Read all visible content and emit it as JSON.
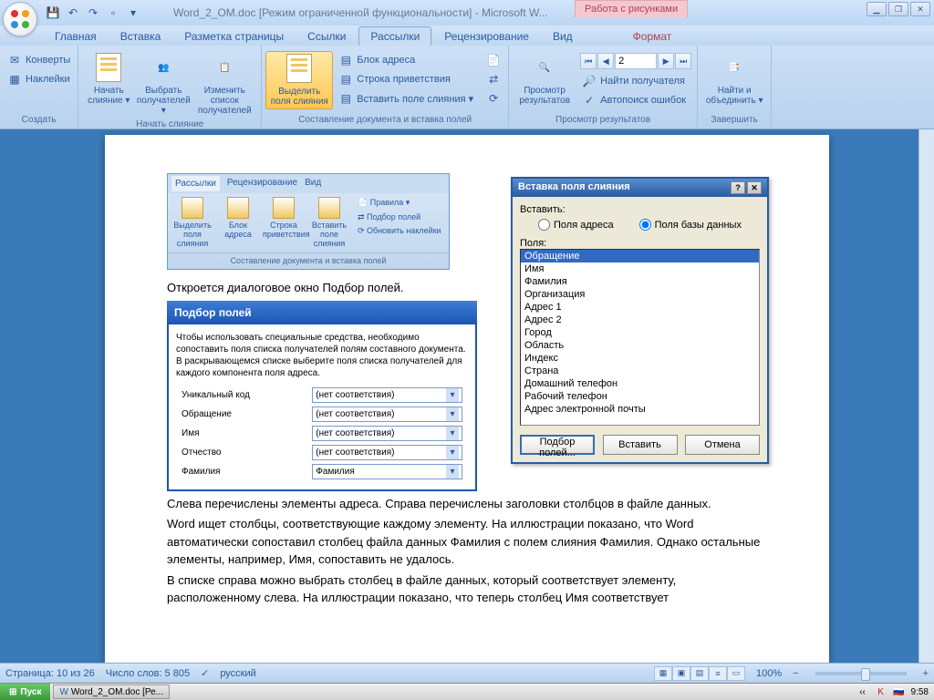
{
  "titlebar": {
    "title": "Word_2_OM.doc [Режим ограниченной функциональности] - Microsoft W...",
    "context_tab": "Работа с рисунками"
  },
  "ribbon_tabs": [
    "Главная",
    "Вставка",
    "Разметка страницы",
    "Ссылки",
    "Рассылки",
    "Рецензирование",
    "Вид",
    "Формат"
  ],
  "ribbon_active": "Рассылки",
  "ribbon": {
    "g1": {
      "label": "Создать",
      "envelopes": "Конверты",
      "labels": "Наклейки"
    },
    "g2": {
      "label": "Начать слияние",
      "start": "Начать слияние ▾",
      "select": "Выбрать получателей ▾",
      "edit": "Изменить список получателей"
    },
    "g3": {
      "label": "Составление документа и вставка полей",
      "highlight": "Выделить поля слияния",
      "addr": "Блок адреса",
      "greet": "Строка приветствия",
      "insfield": "Вставить поле слияния ▾"
    },
    "g4": {
      "label": "Просмотр результатов",
      "preview": "Просмотр результатов",
      "find": "Найти получателя",
      "autocheck": "Автопоиск ошибок"
    },
    "g5": {
      "label": "Завершить",
      "finish": "Найти и объединить ▾"
    },
    "nav_value": "2"
  },
  "doc": {
    "embed_tabs": [
      "Рассылки",
      "Рецензирование",
      "Вид"
    ],
    "embed_btns": [
      "Выделить поля слияния",
      "Блок адреса",
      "Строка приветствия",
      "Вставить поле слияния"
    ],
    "embed_side": [
      "Правила ▾",
      "Подбор полей",
      "Обновить наклейки"
    ],
    "embed_footer": "Составление документа и вставка полей",
    "p1": "Откроется диалоговое окно Подбор полей.",
    "dlg_title": "Подбор полей",
    "dlg_text": "Чтобы использовать специальные средства, необходимо сопоставить поля списка получателей полям составного документа. В раскрывающемся списке выберите поля списка получателей для каждого компонента поля адреса.",
    "rows": [
      {
        "l": "Уникальный код",
        "r": "(нет соответствия)"
      },
      {
        "l": "Обращение",
        "r": "(нет соответствия)"
      },
      {
        "l": "Имя",
        "r": "(нет соответствия)"
      },
      {
        "l": "Отчество",
        "r": "(нет соответствия)"
      },
      {
        "l": "Фамилия",
        "r": "Фамилия"
      }
    ],
    "p2": "Слева перечислены элементы адреса. Справа перечислены заголовки столбцов в файле данных.",
    "p3": "Word ищет столбцы, соответствующие каждому элементу. На иллюстрации показано, что Word автоматически сопоставил столбец файла данных Фамилия с полем слияния Фамилия. Однако остальные элементы, например, Имя, сопоставить не удалось.",
    "p4": "В списке справа можно выбрать столбец в файле данных, который соответствует элементу, расположенному слева. На иллюстрации показано, что теперь столбец Имя соответствует"
  },
  "mergefield": {
    "title": "Вставка поля слияния",
    "insert_label": "Вставить:",
    "radio1": "Поля адреса",
    "radio2": "Поля базы данных",
    "fields_label": "Поля:",
    "items": [
      "Обращение",
      "Имя",
      "Фамилия",
      "Организация",
      "Адрес 1",
      "Адрес 2",
      "Город",
      "Область",
      "Индекс",
      "Страна",
      "Домашний телефон",
      "Рабочий телефон",
      "Адрес электронной почты"
    ],
    "selected": "Обращение",
    "btn_match": "Подбор полей...",
    "btn_insert": "Вставить",
    "btn_cancel": "Отмена"
  },
  "status": {
    "page": "Страница: 10 из 26",
    "words": "Число слов: 5 805",
    "lang": "русский",
    "zoom": "100%"
  },
  "taskbar": {
    "start": "Пуск",
    "task1": "Word_2_OM.doc [Ре...",
    "time": "9:58"
  }
}
